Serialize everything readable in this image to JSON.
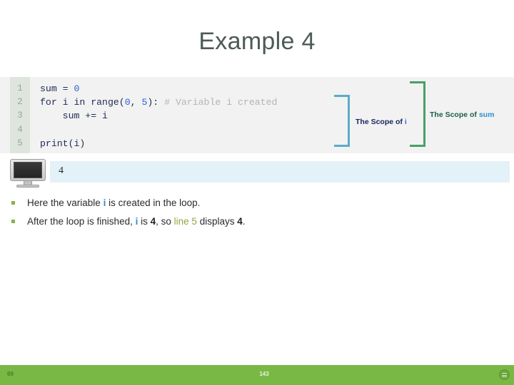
{
  "slide": {
    "title": "Example 4"
  },
  "code": {
    "line_numbers": [
      "1",
      "2",
      "3",
      "4",
      "5"
    ],
    "lines": [
      {
        "parts": [
          {
            "t": "sum = ",
            "k": "plain"
          },
          {
            "t": "0",
            "k": "num"
          }
        ]
      },
      {
        "parts": [
          {
            "t": "for i in range(",
            "k": "plain"
          },
          {
            "t": "0",
            "k": "num"
          },
          {
            "t": ", ",
            "k": "plain"
          },
          {
            "t": "5",
            "k": "num"
          },
          {
            "t": "): ",
            "k": "plain"
          },
          {
            "t": "# Variable i created",
            "k": "comment"
          }
        ]
      },
      {
        "parts": [
          {
            "t": "    sum += i",
            "k": "plain"
          }
        ]
      },
      {
        "parts": [
          {
            "t": "",
            "k": "plain"
          }
        ]
      },
      {
        "parts": [
          {
            "t": "print(i)",
            "k": "plain"
          }
        ]
      }
    ]
  },
  "annotations": {
    "scope_i": {
      "label_prefix": "The Scope of ",
      "label_var": "i",
      "bracket_color": "#5aadc4",
      "text_color": "#17255e"
    },
    "scope_sum": {
      "label_prefix": "The Scope of ",
      "label_var": "sum",
      "bracket_color": "#4a9e6a",
      "text_color": "#1d5f4a"
    }
  },
  "output": {
    "icon": "monitor-icon",
    "value": "4"
  },
  "bullets": [
    {
      "parts": [
        {
          "t": "Here the variable ",
          "k": "plain"
        },
        {
          "t": "i",
          "k": "blue"
        },
        {
          "t": " is created in the loop.",
          "k": "plain"
        }
      ]
    },
    {
      "parts": [
        {
          "t": "After the loop is finished, ",
          "k": "plain"
        },
        {
          "t": "i",
          "k": "blue"
        },
        {
          "t": " is ",
          "k": "plain"
        },
        {
          "t": "4",
          "k": "bold"
        },
        {
          "t": ", so ",
          "k": "plain"
        },
        {
          "t": "line 5",
          "k": "olive"
        },
        {
          "t": " displays ",
          "k": "plain"
        },
        {
          "t": "4",
          "k": "bold"
        },
        {
          "t": ".",
          "k": "plain"
        }
      ]
    }
  ],
  "footer": {
    "left_number": "69",
    "center_number": "143",
    "menu_icon": "hamburger-circle-icon",
    "background": "#7ab845"
  }
}
